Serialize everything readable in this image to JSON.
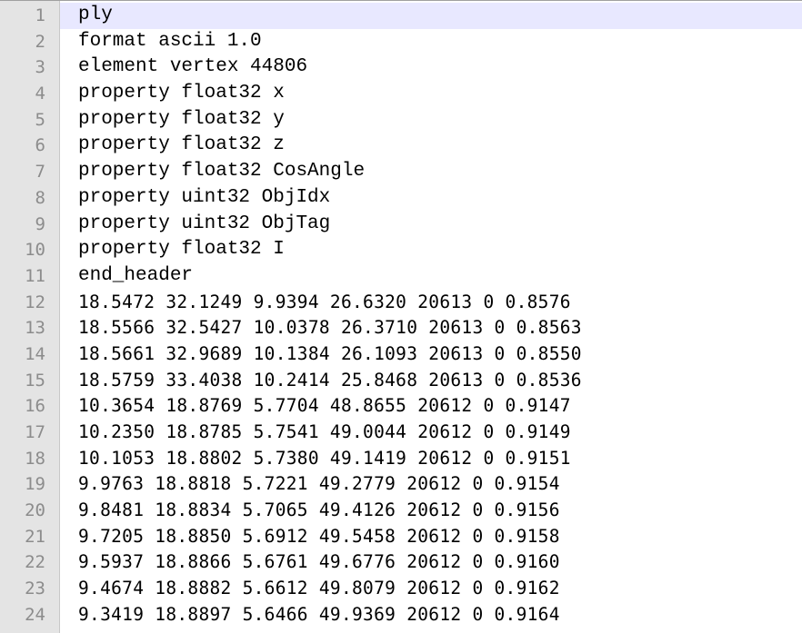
{
  "editor": {
    "current_line": 1,
    "lines": [
      {
        "num": "1",
        "text": "ply",
        "kind": "header"
      },
      {
        "num": "2",
        "text": "format ascii 1.0",
        "kind": "header"
      },
      {
        "num": "3",
        "text": "element vertex 44806",
        "kind": "header"
      },
      {
        "num": "4",
        "text": "property float32 x",
        "kind": "header"
      },
      {
        "num": "5",
        "text": "property float32 y",
        "kind": "header"
      },
      {
        "num": "6",
        "text": "property float32 z",
        "kind": "header"
      },
      {
        "num": "7",
        "text": "property float32 CosAngle",
        "kind": "header"
      },
      {
        "num": "8",
        "text": "property uint32 ObjIdx",
        "kind": "header"
      },
      {
        "num": "9",
        "text": "property uint32 ObjTag",
        "kind": "header"
      },
      {
        "num": "10",
        "text": "property float32 I",
        "kind": "header"
      },
      {
        "num": "11",
        "text": "end_header",
        "kind": "header"
      },
      {
        "num": "12",
        "text": "18.5472 32.1249 9.9394 26.6320 20613 0 0.8576",
        "kind": "data"
      },
      {
        "num": "13",
        "text": "18.5566 32.5427 10.0378 26.3710 20613 0 0.8563",
        "kind": "data"
      },
      {
        "num": "14",
        "text": "18.5661 32.9689 10.1384 26.1093 20613 0 0.8550",
        "kind": "data"
      },
      {
        "num": "15",
        "text": "18.5759 33.4038 10.2414 25.8468 20613 0 0.8536",
        "kind": "data"
      },
      {
        "num": "16",
        "text": "10.3654 18.8769 5.7704 48.8655 20612 0 0.9147",
        "kind": "data"
      },
      {
        "num": "17",
        "text": "10.2350 18.8785 5.7541 49.0044 20612 0 0.9149",
        "kind": "data"
      },
      {
        "num": "18",
        "text": "10.1053 18.8802 5.7380 49.1419 20612 0 0.9151",
        "kind": "data"
      },
      {
        "num": "19",
        "text": "9.9763 18.8818 5.7221 49.2779 20612 0 0.9154",
        "kind": "data"
      },
      {
        "num": "20",
        "text": "9.8481 18.8834 5.7065 49.4126 20612 0 0.9156",
        "kind": "data"
      },
      {
        "num": "21",
        "text": "9.7205 18.8850 5.6912 49.5458 20612 0 0.9158",
        "kind": "data"
      },
      {
        "num": "22",
        "text": "9.5937 18.8866 5.6761 49.6776 20612 0 0.9160",
        "kind": "data"
      },
      {
        "num": "23",
        "text": "9.4674 18.8882 5.6612 49.8079 20612 0 0.9162",
        "kind": "data"
      },
      {
        "num": "24",
        "text": "9.3419 18.8897 5.6466 49.9369 20612 0 0.9164",
        "kind": "data"
      }
    ]
  }
}
